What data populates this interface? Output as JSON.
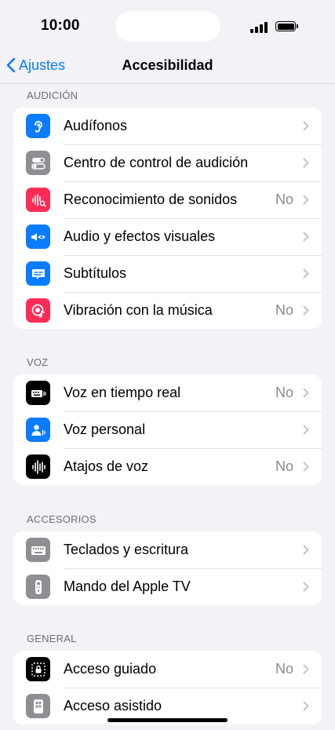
{
  "status_bar": {
    "time": "10:00"
  },
  "nav": {
    "back_label": "Ajustes",
    "title": "Accesibilidad"
  },
  "colors": {
    "accent": "#0a7cff",
    "blue": "#0a7cff",
    "gray": "#8e8e93",
    "pink": "#ff2d55",
    "black": "#000000"
  },
  "sections": [
    {
      "header": "AUDICIÓN",
      "items": [
        {
          "label": "Audífonos",
          "value": "",
          "icon": "ear-icon"
        },
        {
          "label": "Centro de control de audición",
          "value": "",
          "icon": "toggles-icon"
        },
        {
          "label": "Reconocimiento de sonidos",
          "value": "No",
          "icon": "waveform-search-icon"
        },
        {
          "label": "Audio y efectos visuales",
          "value": "",
          "icon": "speaker-eye-icon"
        },
        {
          "label": "Subtítulos",
          "value": "",
          "icon": "captions-icon"
        },
        {
          "label": "Vibración con la música",
          "value": "No",
          "icon": "music-vibration-icon"
        }
      ]
    },
    {
      "header": "VOZ",
      "items": [
        {
          "label": "Voz en tiempo real",
          "value": "No",
          "icon": "keyboard-speech-icon"
        },
        {
          "label": "Voz personal",
          "value": "",
          "icon": "person-wave-icon"
        },
        {
          "label": "Atajos de voz",
          "value": "No",
          "icon": "waveform-icon"
        }
      ]
    },
    {
      "header": "ACCESORIOS",
      "items": [
        {
          "label": "Teclados y escritura",
          "value": "",
          "icon": "keyboard-icon"
        },
        {
          "label": "Mando del Apple TV",
          "value": "",
          "icon": "remote-icon"
        }
      ]
    },
    {
      "header": "GENERAL",
      "items": [
        {
          "label": "Acceso guiado",
          "value": "No",
          "icon": "lock-frame-icon"
        },
        {
          "label": "Acceso asistido",
          "value": "",
          "icon": "phone-grid-icon"
        }
      ]
    }
  ]
}
